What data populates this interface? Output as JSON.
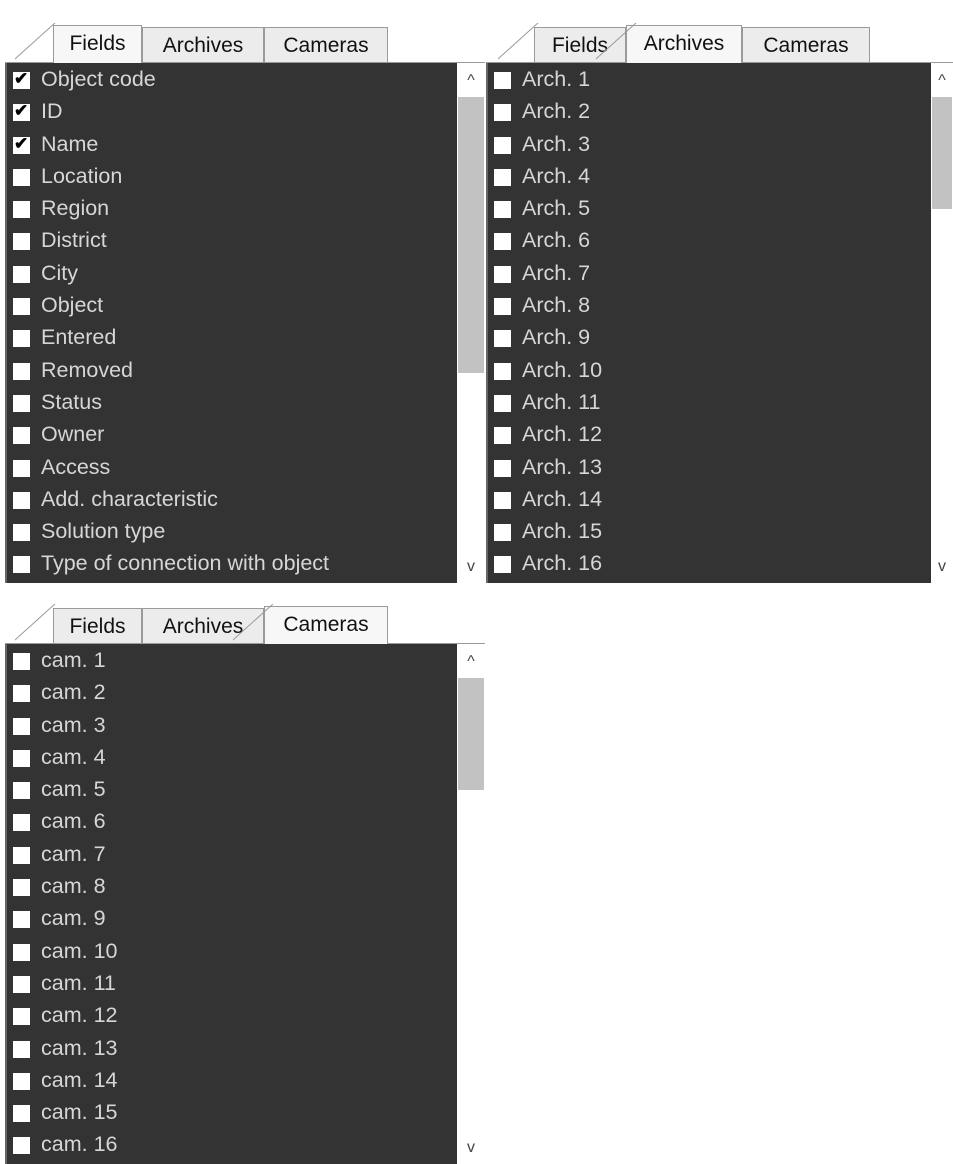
{
  "tabs": [
    "Fields",
    "Archives",
    "Cameras"
  ],
  "scroll_glyphs": {
    "up": "^",
    "down": "v"
  },
  "check_glyph": "✔",
  "panels": {
    "fields": {
      "active_tab": "Fields",
      "items": [
        {
          "label": "Object code",
          "checked": true
        },
        {
          "label": "ID",
          "checked": true
        },
        {
          "label": "Name",
          "checked": true
        },
        {
          "label": "Location",
          "checked": false
        },
        {
          "label": "Region",
          "checked": false
        },
        {
          "label": "District",
          "checked": false
        },
        {
          "label": "City",
          "checked": false
        },
        {
          "label": "Object",
          "checked": false
        },
        {
          "label": "Entered",
          "checked": false
        },
        {
          "label": "Removed",
          "checked": false
        },
        {
          "label": "Status",
          "checked": false
        },
        {
          "label": "Owner",
          "checked": false
        },
        {
          "label": "Access",
          "checked": false
        },
        {
          "label": "Add. characteristic",
          "checked": false
        },
        {
          "label": "Solution type",
          "checked": false
        },
        {
          "label": "Type of connection with object",
          "checked": false
        }
      ]
    },
    "archives": {
      "active_tab": "Archives",
      "items": [
        {
          "label": "Arch. 1",
          "checked": false
        },
        {
          "label": "Arch. 2",
          "checked": false
        },
        {
          "label": "Arch. 3",
          "checked": false
        },
        {
          "label": "Arch. 4",
          "checked": false
        },
        {
          "label": "Arch. 5",
          "checked": false
        },
        {
          "label": "Arch. 6",
          "checked": false
        },
        {
          "label": "Arch. 7",
          "checked": false
        },
        {
          "label": "Arch. 8",
          "checked": false
        },
        {
          "label": "Arch. 9",
          "checked": false
        },
        {
          "label": "Arch. 10",
          "checked": false
        },
        {
          "label": "Arch. 11",
          "checked": false
        },
        {
          "label": "Arch. 12",
          "checked": false
        },
        {
          "label": "Arch. 13",
          "checked": false
        },
        {
          "label": "Arch. 14",
          "checked": false
        },
        {
          "label": "Arch. 15",
          "checked": false
        },
        {
          "label": "Arch. 16",
          "checked": false
        }
      ]
    },
    "cameras": {
      "active_tab": "Cameras",
      "items": [
        {
          "label": "cam. 1",
          "checked": false
        },
        {
          "label": "cam. 2",
          "checked": false
        },
        {
          "label": "cam. 3",
          "checked": false
        },
        {
          "label": "cam. 4",
          "checked": false
        },
        {
          "label": "cam. 5",
          "checked": false
        },
        {
          "label": "cam. 6",
          "checked": false
        },
        {
          "label": "cam. 7",
          "checked": false
        },
        {
          "label": "cam. 8",
          "checked": false
        },
        {
          "label": "cam. 9",
          "checked": false
        },
        {
          "label": "cam. 10",
          "checked": false
        },
        {
          "label": "cam. 11",
          "checked": false
        },
        {
          "label": "cam. 12",
          "checked": false
        },
        {
          "label": "cam. 13",
          "checked": false
        },
        {
          "label": "cam. 14",
          "checked": false
        },
        {
          "label": "cam. 15",
          "checked": false
        },
        {
          "label": "cam. 16",
          "checked": false
        }
      ]
    }
  }
}
